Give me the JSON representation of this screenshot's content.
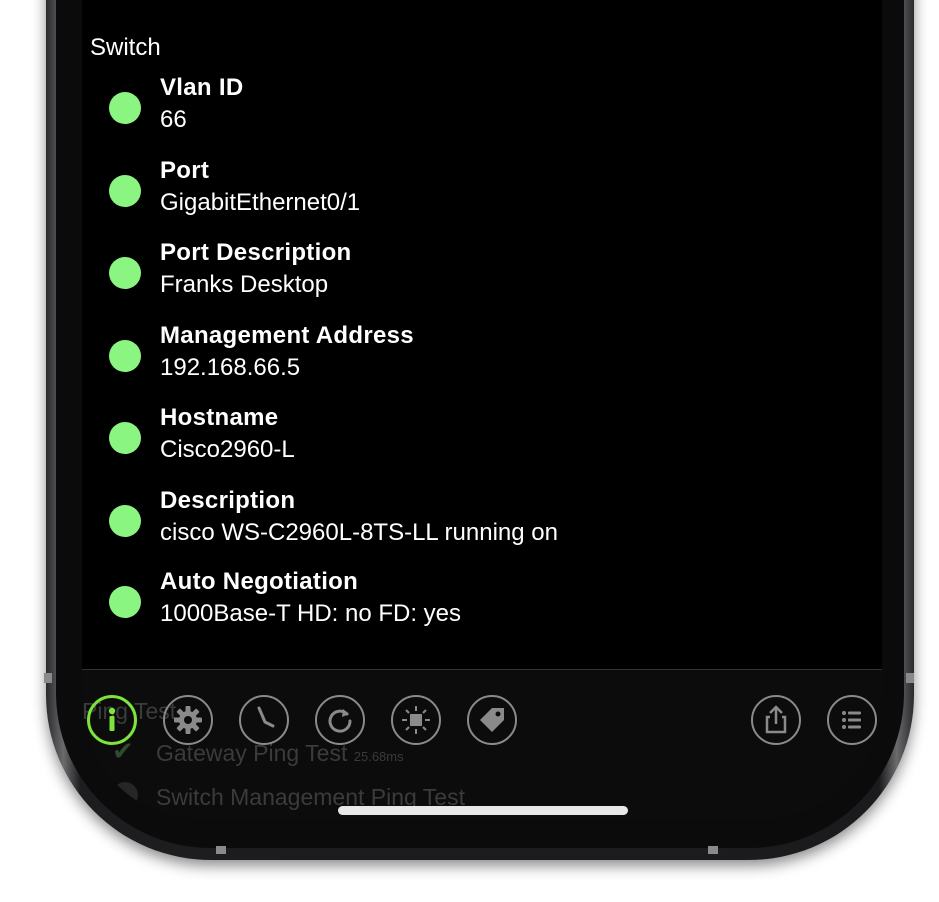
{
  "section_title": "Switch",
  "status_color": "#8af580",
  "active_tab_color": "#7ee33c",
  "items": [
    {
      "label": "Vlan ID",
      "value": "66"
    },
    {
      "label": "Port",
      "value": "GigabitEthernet0/1"
    },
    {
      "label": "Port Description",
      "value": "Franks Desktop"
    },
    {
      "label": "Management Address",
      "value": "192.168.66.5"
    },
    {
      "label": "Hostname",
      "value": "Cisco2960-L"
    },
    {
      "label": "Description",
      "value": "cisco WS-C2960L-8TS-LL running on"
    },
    {
      "label": "Auto Negotiation",
      "value": "1000Base-T HD: no FD: yes"
    }
  ],
  "background_list": {
    "header": "Ping Test",
    "items": [
      {
        "label": "Gateway Ping Test",
        "detail": "25.68ms"
      },
      {
        "label": "Switch Management Ping Test",
        "detail": ""
      }
    ]
  },
  "tabs": [
    {
      "icon": "info-icon",
      "active": true
    },
    {
      "icon": "gear-icon",
      "active": false
    },
    {
      "icon": "clock-icon",
      "active": false
    },
    {
      "icon": "refresh-icon",
      "active": false
    },
    {
      "icon": "chip-icon",
      "active": false
    },
    {
      "icon": "tag-icon",
      "active": false
    },
    {
      "icon": "share-icon",
      "active": false
    },
    {
      "icon": "list-icon",
      "active": false
    }
  ]
}
